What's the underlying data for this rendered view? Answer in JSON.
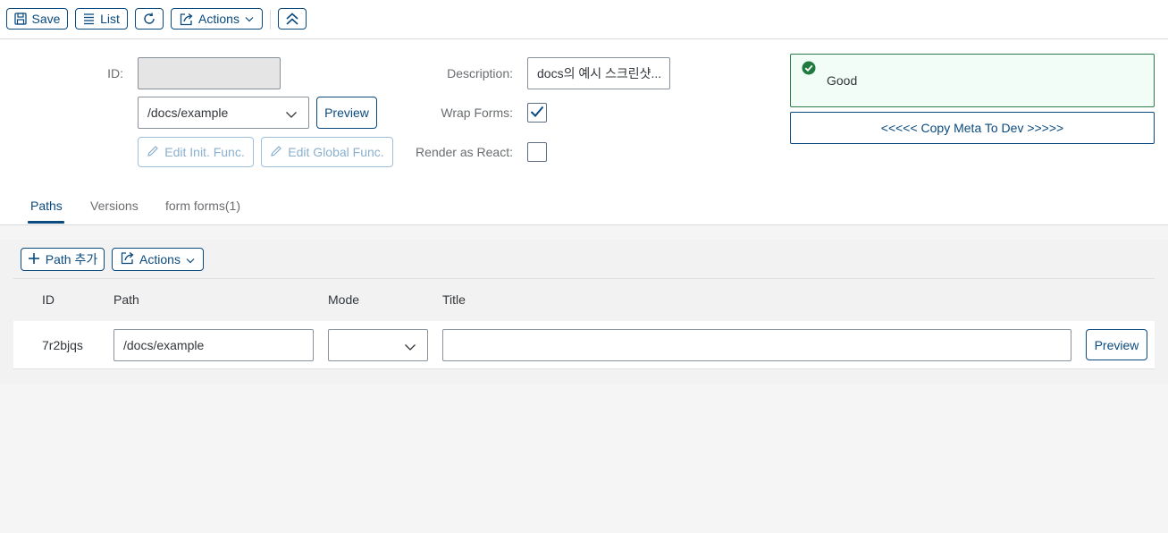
{
  "toolbar": {
    "save_label": "Save",
    "list_label": "List",
    "actions_label": "Actions"
  },
  "form": {
    "id_label": "ID:",
    "id_value": "",
    "path_value": "/docs/example",
    "preview_label": "Preview",
    "edit_init_label": "Edit Init. Func.",
    "edit_global_label": "Edit Global Func.",
    "description_label": "Description:",
    "description_value": "docs의 예시 스크린샷...",
    "wrap_forms_label": "Wrap Forms:",
    "wrap_forms_checked": true,
    "render_react_label": "Render as React:",
    "render_react_checked": false
  },
  "status": {
    "message": "Good",
    "color": "#2b7c4a",
    "copy_label": "<<<<< Copy Meta To Dev >>>>>"
  },
  "tabs": [
    {
      "label": "Paths",
      "active": true
    },
    {
      "label": "Versions",
      "active": false
    },
    {
      "label": "form forms(1)",
      "active": false
    }
  ],
  "paths": {
    "add_label": "Path 추가",
    "actions_label": "Actions",
    "columns": [
      "ID",
      "Path",
      "Mode",
      "Title"
    ],
    "rows": [
      {
        "id": "7r2bjqs",
        "path": "/docs/example",
        "mode": "",
        "title": "",
        "preview_label": "Preview"
      }
    ]
  },
  "colors": {
    "accent": "#0a4a7e",
    "success": "#2b7c4a"
  }
}
